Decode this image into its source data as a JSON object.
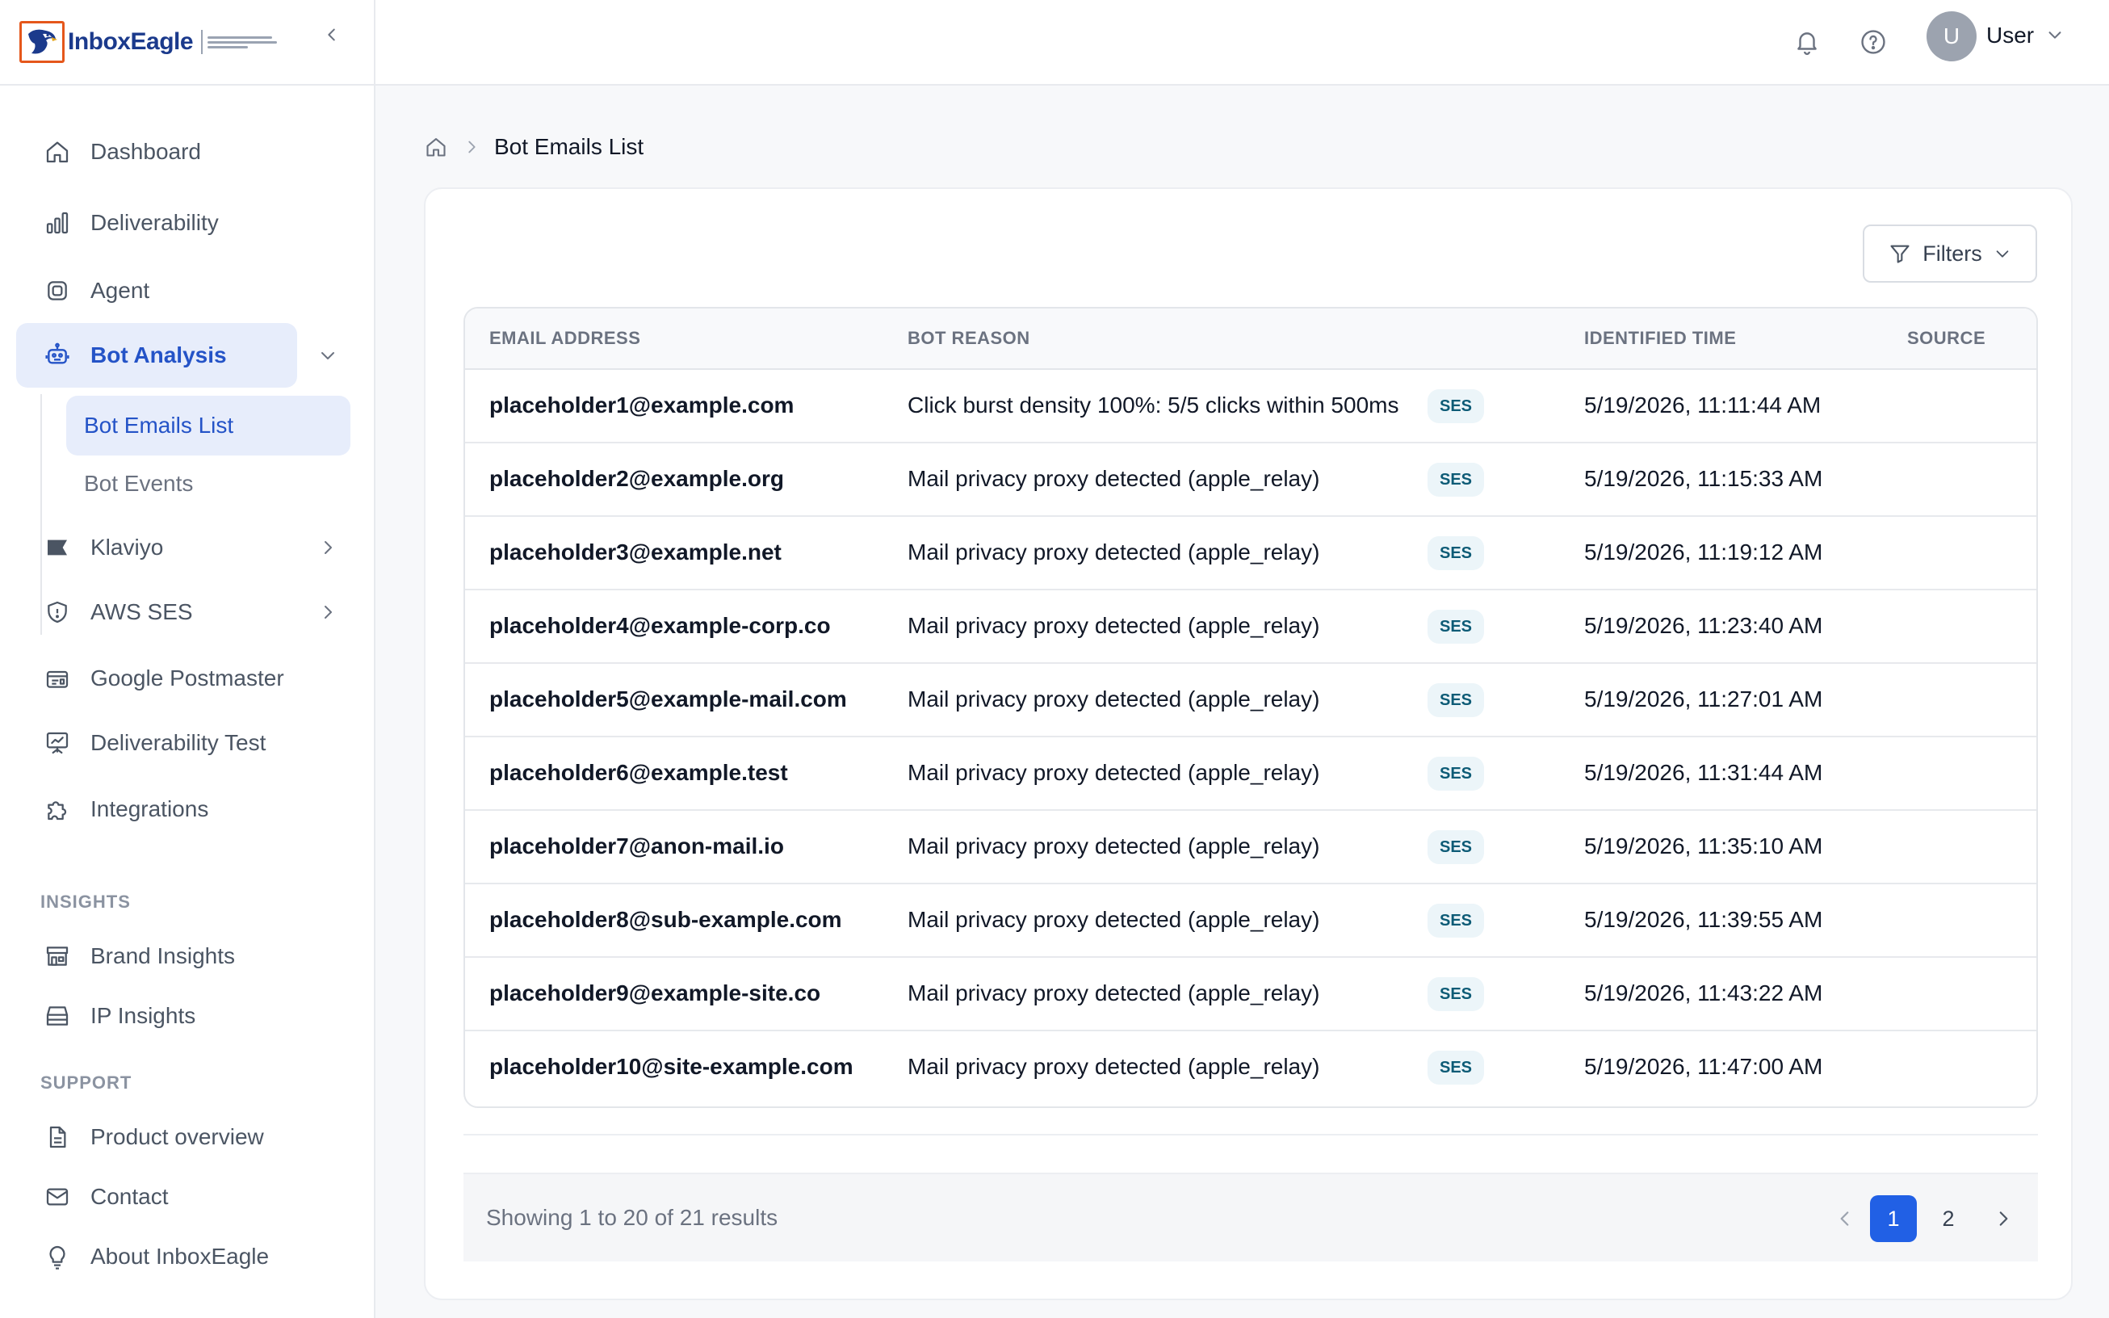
{
  "app": {
    "brand": "InboxEagle"
  },
  "sidebar": {
    "items": [
      {
        "label": "Dashboard",
        "icon": "home-icon"
      },
      {
        "label": "Deliverability",
        "icon": "bar-chart-icon"
      },
      {
        "label": "Agent",
        "icon": "chip-icon"
      },
      {
        "label": "Bot Analysis",
        "icon": "robot-icon",
        "expanded": true,
        "active": true
      },
      {
        "label": "Klaviyo",
        "icon": "flag-icon"
      },
      {
        "label": "AWS SES",
        "icon": "shield-icon"
      },
      {
        "label": "Google Postmaster",
        "icon": "mailbox-icon"
      },
      {
        "label": "Deliverability Test",
        "icon": "presentation-chart-icon"
      },
      {
        "label": "Integrations",
        "icon": "puzzle-icon"
      }
    ],
    "bot_sub": [
      {
        "label": "Bot Emails List",
        "active": true
      },
      {
        "label": "Bot Events"
      }
    ],
    "insights_label": "INSIGHTS",
    "insights": [
      {
        "label": "Brand Insights",
        "icon": "store-icon"
      },
      {
        "label": "IP Insights",
        "icon": "server-icon"
      }
    ],
    "support_label": "SUPPORT",
    "support": [
      {
        "label": "Product overview",
        "icon": "document-icon"
      },
      {
        "label": "Contact",
        "icon": "mail-icon"
      },
      {
        "label": "About InboxEagle",
        "icon": "lightbulb-icon"
      }
    ]
  },
  "header": {
    "user_initial": "U",
    "user_name": "User"
  },
  "breadcrumb": {
    "current": "Bot Emails List"
  },
  "toolbar": {
    "filters_label": "Filters"
  },
  "table": {
    "columns": [
      "EMAIL ADDRESS",
      "BOT REASON",
      "IDENTIFIED TIME",
      "SOURCE"
    ],
    "rows": [
      {
        "email": "placeholder1@example.com",
        "reason": "Click burst density 100%: 5/5 clicks within 500ms",
        "time": "5/19/2026, 11:11:44 AM",
        "source": "SES"
      },
      {
        "email": "placeholder2@example.org",
        "reason": "Mail privacy proxy detected (apple_relay)",
        "time": "5/19/2026, 11:15:33 AM",
        "source": "SES"
      },
      {
        "email": "placeholder3@example.net",
        "reason": "Mail privacy proxy detected (apple_relay)",
        "time": "5/19/2026, 11:19:12 AM",
        "source": "SES"
      },
      {
        "email": "placeholder4@example-corp.co",
        "reason": "Mail privacy proxy detected (apple_relay)",
        "time": "5/19/2026, 11:23:40 AM",
        "source": "SES"
      },
      {
        "email": "placeholder5@example-mail.com",
        "reason": "Mail privacy proxy detected (apple_relay)",
        "time": "5/19/2026, 11:27:01 AM",
        "source": "SES"
      },
      {
        "email": "placeholder6@example.test",
        "reason": "Mail privacy proxy detected (apple_relay)",
        "time": "5/19/2026, 11:31:44 AM",
        "source": "SES"
      },
      {
        "email": "placeholder7@anon-mail.io",
        "reason": "Mail privacy proxy detected (apple_relay)",
        "time": "5/19/2026, 11:35:10 AM",
        "source": "SES"
      },
      {
        "email": "placeholder8@sub-example.com",
        "reason": "Mail privacy proxy detected (apple_relay)",
        "time": "5/19/2026, 11:39:55 AM",
        "source": "SES"
      },
      {
        "email": "placeholder9@example-site.co",
        "reason": "Mail privacy proxy detected (apple_relay)",
        "time": "5/19/2026, 11:43:22 AM",
        "source": "SES"
      },
      {
        "email": "placeholder10@site-example.com",
        "reason": "Mail privacy proxy detected (apple_relay)",
        "time": "5/19/2026, 11:47:00 AM",
        "source": "SES"
      }
    ]
  },
  "pagination": {
    "summary": "Showing 1 to 20 of 21 results",
    "pages": [
      "1",
      "2"
    ],
    "current_page": "1"
  },
  "colors": {
    "accent": "#2453c7",
    "active_bg": "#e7edfb",
    "page_button": "#2160e5",
    "badge_bg": "#ecf5f9",
    "badge_text": "#0d5b76",
    "logo_orange": "#e5571b",
    "logo_blue": "#1b3a8c"
  }
}
